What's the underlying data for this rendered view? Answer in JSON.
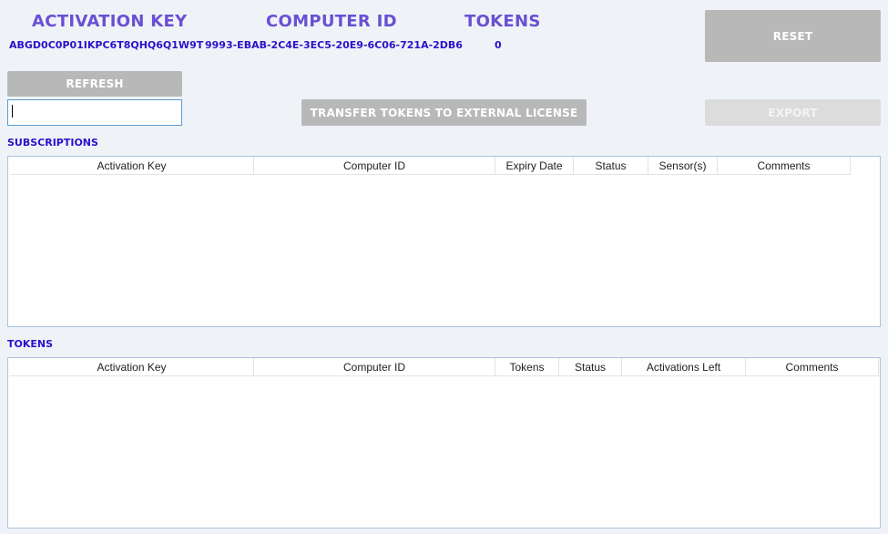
{
  "header": {
    "activation_key_title": "ACTIVATION KEY",
    "activation_key_value": "ABGD0C0P01IKPC6T8QHQ6Q1W9T",
    "computer_id_title": "COMPUTER ID",
    "computer_id_value": "9993-EBAB-2C4E-3EC5-20E9-6C06-721A-2DB6",
    "tokens_title": "TOKENS",
    "tokens_value": "0"
  },
  "buttons": {
    "reset": "RESET",
    "refresh": "REFRESH",
    "transfer": "TRANSFER TOKENS TO EXTERNAL LICENSE",
    "export": "EXPORT"
  },
  "search": {
    "value": ""
  },
  "subscriptions": {
    "label": "SUBSCRIPTIONS",
    "columns": [
      "Activation Key",
      "Computer ID",
      "Expiry Date",
      "Status",
      "Sensor(s)",
      "Comments"
    ],
    "rows": []
  },
  "tokens": {
    "label": "TOKENS",
    "columns": [
      "Activation Key",
      "Computer ID",
      "Tokens",
      "Status",
      "Activations Left",
      "Comments"
    ],
    "rows": []
  },
  "colors": {
    "title": "#6a4fd3",
    "value": "#2c10c9",
    "button": "#b8b8b8",
    "button_disabled": "#dcdcdc",
    "background": "#eff3f7"
  }
}
